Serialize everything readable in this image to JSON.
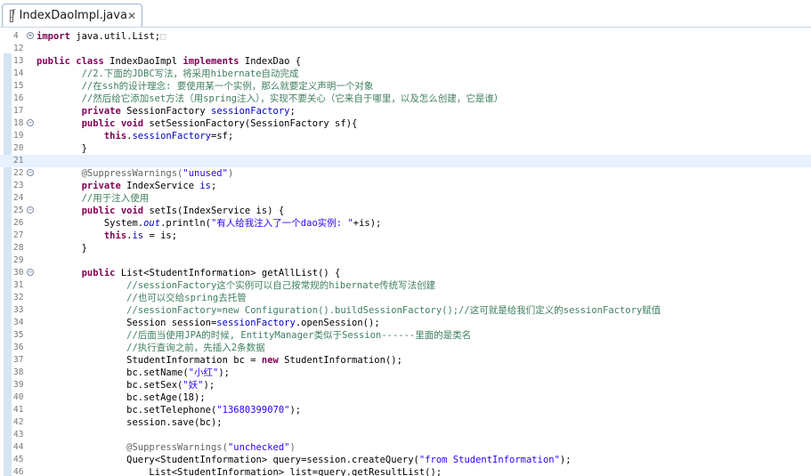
{
  "tab": {
    "title": "IndexDaoImpl.java",
    "close": "✕"
  },
  "lines": [
    {
      "n": "4",
      "segs": [
        {
          "c": "kw",
          "t": "import"
        },
        {
          "c": "",
          "t": " java.util.List;"
        },
        {
          "c": "dot",
          "t": "□"
        }
      ],
      "fold": "+"
    },
    {
      "n": "12",
      "segs": []
    },
    {
      "n": "13",
      "segs": [
        {
          "c": "kw",
          "t": "public class"
        },
        {
          "c": "",
          "t": " IndexDaoImpl "
        },
        {
          "c": "kw",
          "t": "implements"
        },
        {
          "c": "",
          "t": " IndexDao {"
        }
      ]
    },
    {
      "n": "14",
      "segs": [
        {
          "c": "cm",
          "t": "        //2.下面的JDBC写法，将采用hibernate自动完成"
        }
      ]
    },
    {
      "n": "15",
      "segs": [
        {
          "c": "cm",
          "t": "        //在ssh的设计理念: 要使用某一个实例，那么就要定义声明一个对象"
        }
      ]
    },
    {
      "n": "16",
      "segs": [
        {
          "c": "cm",
          "t": "        //然后给它添加set方法（用spring注入），实现不要关心（它来自于哪里，以及怎么创建，它是谁）"
        }
      ]
    },
    {
      "n": "17",
      "segs": [
        {
          "c": "",
          "t": "        "
        },
        {
          "c": "kw",
          "t": "private"
        },
        {
          "c": "",
          "t": " SessionFactory "
        },
        {
          "c": "fd",
          "t": "sessionFactory"
        },
        {
          "c": "",
          "t": ";"
        }
      ]
    },
    {
      "n": "18",
      "segs": [
        {
          "c": "",
          "t": "        "
        },
        {
          "c": "kw",
          "t": "public void"
        },
        {
          "c": "",
          "t": " setSessionFactory(SessionFactory sf){"
        }
      ],
      "fold": "-"
    },
    {
      "n": "19",
      "segs": [
        {
          "c": "",
          "t": "            "
        },
        {
          "c": "kw",
          "t": "this"
        },
        {
          "c": "",
          "t": "."
        },
        {
          "c": "fd",
          "t": "sessionFactory"
        },
        {
          "c": "",
          "t": "=sf;"
        }
      ]
    },
    {
      "n": "20",
      "segs": [
        {
          "c": "",
          "t": "        }"
        }
      ]
    },
    {
      "n": "21",
      "segs": [],
      "hl": true
    },
    {
      "n": "22",
      "segs": [
        {
          "c": "an",
          "t": "        @SuppressWarnings("
        },
        {
          "c": "st",
          "t": "\"unused\""
        },
        {
          "c": "an",
          "t": ")"
        }
      ],
      "fold": "-"
    },
    {
      "n": "23",
      "segs": [
        {
          "c": "",
          "t": "        "
        },
        {
          "c": "kw",
          "t": "private"
        },
        {
          "c": "",
          "t": " IndexService "
        },
        {
          "c": "fd",
          "t": "is"
        },
        {
          "c": "",
          "t": ";"
        }
      ]
    },
    {
      "n": "24",
      "segs": [
        {
          "c": "cm",
          "t": "        //用于注入使用"
        }
      ]
    },
    {
      "n": "25",
      "segs": [
        {
          "c": "",
          "t": "        "
        },
        {
          "c": "kw",
          "t": "public void"
        },
        {
          "c": "",
          "t": " setIs(IndexService is) {"
        }
      ],
      "fold": "-"
    },
    {
      "n": "26",
      "segs": [
        {
          "c": "",
          "t": "            System."
        },
        {
          "c": "fd it",
          "t": "out"
        },
        {
          "c": "",
          "t": ".println("
        },
        {
          "c": "st",
          "t": "\"有人给我注入了一个dao实例: \""
        },
        {
          "c": "",
          "t": "+is);"
        }
      ]
    },
    {
      "n": "27",
      "segs": [
        {
          "c": "",
          "t": "            "
        },
        {
          "c": "kw",
          "t": "this"
        },
        {
          "c": "",
          "t": "."
        },
        {
          "c": "fd",
          "t": "is"
        },
        {
          "c": "",
          "t": " = is;"
        }
      ]
    },
    {
      "n": "28",
      "segs": [
        {
          "c": "",
          "t": "        }"
        }
      ]
    },
    {
      "n": "29",
      "segs": []
    },
    {
      "n": "30",
      "segs": [
        {
          "c": "",
          "t": "        "
        },
        {
          "c": "kw",
          "t": "public"
        },
        {
          "c": "",
          "t": " List<StudentInformation> getAllList() {"
        }
      ],
      "fold": "-"
    },
    {
      "n": "31",
      "segs": [
        {
          "c": "cm",
          "t": "                //sessionFactory这个实例可以自己按常规的hibernate传统写法创建"
        }
      ]
    },
    {
      "n": "32",
      "segs": [
        {
          "c": "cm",
          "t": "                //也可以交给spring去托管"
        }
      ]
    },
    {
      "n": "33",
      "segs": [
        {
          "c": "cm",
          "t": "                //sessionFactory=new Configuration().buildSessionFactory();//这可就是给我们定义的sessionFactory赋值"
        }
      ]
    },
    {
      "n": "34",
      "segs": [
        {
          "c": "",
          "t": "                Session session="
        },
        {
          "c": "fd",
          "t": "sessionFactory"
        },
        {
          "c": "",
          "t": ".openSession();"
        }
      ]
    },
    {
      "n": "35",
      "segs": [
        {
          "c": "cm",
          "t": "                //后面当使用JPA的时候, EntityManager类似于Session------里面的是类名"
        }
      ]
    },
    {
      "n": "36",
      "segs": [
        {
          "c": "cm",
          "t": "                //执行查询之前，先插入2条数据"
        }
      ]
    },
    {
      "n": "37",
      "segs": [
        {
          "c": "",
          "t": "                StudentInformation bc = "
        },
        {
          "c": "kw",
          "t": "new"
        },
        {
          "c": "",
          "t": " StudentInformation();"
        }
      ]
    },
    {
      "n": "38",
      "segs": [
        {
          "c": "",
          "t": "                bc.setName("
        },
        {
          "c": "st",
          "t": "\"小红\""
        },
        {
          "c": "",
          "t": ");"
        }
      ]
    },
    {
      "n": "39",
      "segs": [
        {
          "c": "",
          "t": "                bc.setSex("
        },
        {
          "c": "st",
          "t": "\"妖\""
        },
        {
          "c": "",
          "t": ");"
        }
      ]
    },
    {
      "n": "40",
      "segs": [
        {
          "c": "",
          "t": "                bc.setAge(18);"
        }
      ]
    },
    {
      "n": "41",
      "segs": [
        {
          "c": "",
          "t": "                bc.setTelephone("
        },
        {
          "c": "st",
          "t": "\"13680399070\""
        },
        {
          "c": "",
          "t": ");"
        }
      ]
    },
    {
      "n": "42",
      "segs": [
        {
          "c": "",
          "t": "                session.save(bc);"
        }
      ]
    },
    {
      "n": "43",
      "segs": []
    },
    {
      "n": "44",
      "segs": [
        {
          "c": "an",
          "t": "                @SuppressWarnings("
        },
        {
          "c": "st",
          "t": "\"unchecked\""
        },
        {
          "c": "an",
          "t": ")"
        }
      ]
    },
    {
      "n": "45",
      "segs": [
        {
          "c": "",
          "t": "                Query<StudentInformation> query=session.createQuery("
        },
        {
          "c": "st",
          "t": "\"from StudentInformation\""
        },
        {
          "c": "",
          "t": ");"
        }
      ]
    },
    {
      "n": "46",
      "segs": [
        {
          "c": "",
          "t": "                    List<StudentInformation> list=query.getResultList();"
        }
      ]
    }
  ]
}
